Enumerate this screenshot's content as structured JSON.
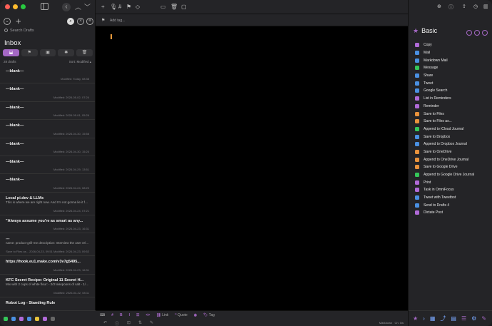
{
  "left": {
    "search_placeholder": "Search Drafts",
    "inbox_title": "Inbox",
    "draft_count": "28 drafts",
    "sort_label": "Sort: Modified ▴",
    "drafts": [
      {
        "title": "—blank—",
        "body": "",
        "modified": "Modified: Today, 08:38"
      },
      {
        "title": "—blank—",
        "body": "",
        "modified": "Modified: 2026-05-02, 07:24"
      },
      {
        "title": "—blank—",
        "body": "",
        "modified": "Modified: 2026-05-01, 05:26"
      },
      {
        "title": "—blank—",
        "body": "",
        "modified": "Modified: 2026-04-30, 15:58"
      },
      {
        "title": "—blank—",
        "body": "",
        "modified": "Modified: 2026-04-30, 15:24"
      },
      {
        "title": "—blank—",
        "body": "",
        "modified": "Modified: 2026-04-29, 13:51"
      },
      {
        "title": "—blank—",
        "body": "",
        "modified": "Modified: 2026-04-24, 08:20"
      },
      {
        "title": "Local pi.dev & LLMs",
        "body": "This is where we are right now. And I'm not gonna lie it feels pretty magical !! 🪄 [https://bb...",
        "modified": "Modified: 2026-04-24, 07:21"
      },
      {
        "title": "\"Always assume you're as smart as any...",
        "body": "",
        "modified": "Modified: 2026-04-23, 16:31"
      },
      {
        "title": "---",
        "body": "name: product-grill-me  description: Interview the user relentlessly about a product design unti...",
        "modified": "Save to Files as... 2026-04-23, 09:51  Modified: 2026-04-23, 09:52"
      },
      {
        "title": "https://hook.eu1.make.com/v3v7g5495...",
        "body": "",
        "modified": "Modified: 2026-04-23, 16:31"
      },
      {
        "title": "KFC Secret Recipe: Original 11 Secret H...",
        "body": "Mix with 2 cups of white flour:  - 2/3 teaspoons of salt  - 1/2 teaspoons of thyme  -...",
        "modified": "Modified: 2026-04-22, 08:11"
      },
      {
        "title": "Robot Log - Standing Rule",
        "body": "",
        "modified": ""
      }
    ]
  },
  "center": {
    "tag_placeholder": "Add tag...",
    "format_labels": [
      "Link",
      "Quote",
      "Tag"
    ],
    "status_mode": "Markdown",
    "status_position": "Ch: 0w"
  },
  "right": {
    "group_title": "Basic",
    "actions": [
      {
        "label": "Copy",
        "color": "#b06ad8"
      },
      {
        "label": "Mail",
        "color": "#4a90e2"
      },
      {
        "label": "Markdown Mail",
        "color": "#4a90e2"
      },
      {
        "label": "Message",
        "color": "#35c759"
      },
      {
        "label": "Share",
        "color": "#4a90e2"
      },
      {
        "label": "Tweet",
        "color": "#4a90e2"
      },
      {
        "label": "Google Search",
        "color": "#4a90e2"
      },
      {
        "label": "List in Reminders",
        "color": "#b06ad8"
      },
      {
        "label": "Reminder",
        "color": "#b06ad8"
      },
      {
        "label": "Save to Files",
        "color": "#e8923c"
      },
      {
        "label": "Save to Files as...",
        "color": "#e8923c"
      },
      {
        "label": "Append to iCloud Journal",
        "color": "#35c759"
      },
      {
        "label": "Save to Dropbox",
        "color": "#4a90e2"
      },
      {
        "label": "Append to Dropbox Journal",
        "color": "#4a90e2"
      },
      {
        "label": "Save to OneDrive",
        "color": "#e8923c"
      },
      {
        "label": "Append to OneDrive Journal",
        "color": "#e8923c"
      },
      {
        "label": "Save to Google Drive",
        "color": "#e8923c"
      },
      {
        "label": "Append to Google Drive Journal",
        "color": "#35c759"
      },
      {
        "label": "Print",
        "color": "#b06ad8"
      },
      {
        "label": "Task in OmniFocus",
        "color": "#b06ad8"
      },
      {
        "label": "Tweet with Tweetbot",
        "color": "#4a90e2"
      },
      {
        "label": "Send to Drafts 4",
        "color": "#4a90e2"
      },
      {
        "label": "Dictate Post",
        "color": "#b06ad8"
      }
    ]
  }
}
